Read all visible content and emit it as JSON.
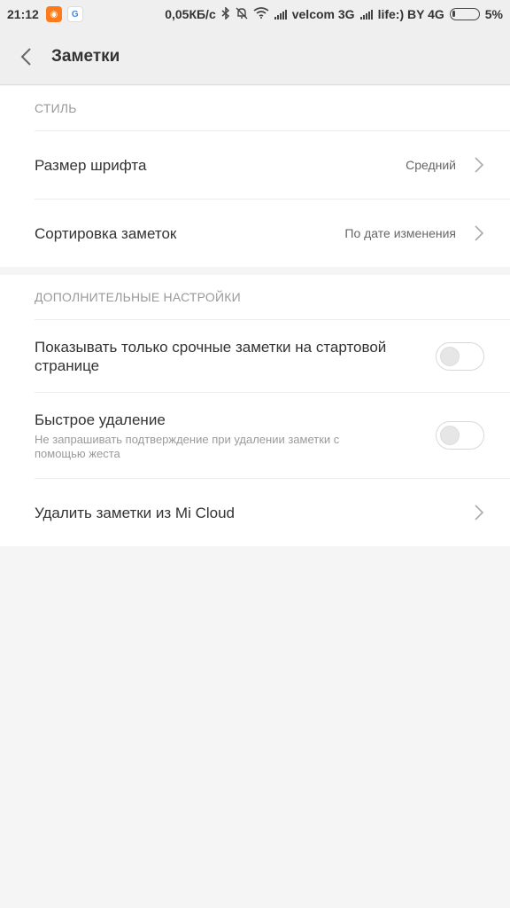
{
  "statusbar": {
    "time": "21:12",
    "speed": "0,05КБ/с",
    "carrier1": "velcom 3G",
    "carrier2": "life:) BY 4G",
    "battery": "5%"
  },
  "header": {
    "title": "Заметки"
  },
  "style_section": {
    "label": "СТИЛЬ",
    "font_size": {
      "title": "Размер шрифта",
      "value": "Средний"
    },
    "sort": {
      "title": "Сортировка заметок",
      "value": "По дате изменения"
    }
  },
  "extra_section": {
    "label": "ДОПОЛНИТЕЛЬНЫЕ НАСТРОЙКИ",
    "urgent": {
      "title": "Показывать только срочные заметки на стартовой странице",
      "enabled": false
    },
    "quick_delete": {
      "title": "Быстрое удаление",
      "subtitle": "Не запрашивать подтверждение при удалении заметки с помощью жеста",
      "enabled": false
    },
    "cloud_delete": {
      "title": "Удалить заметки из Mi Cloud"
    }
  }
}
